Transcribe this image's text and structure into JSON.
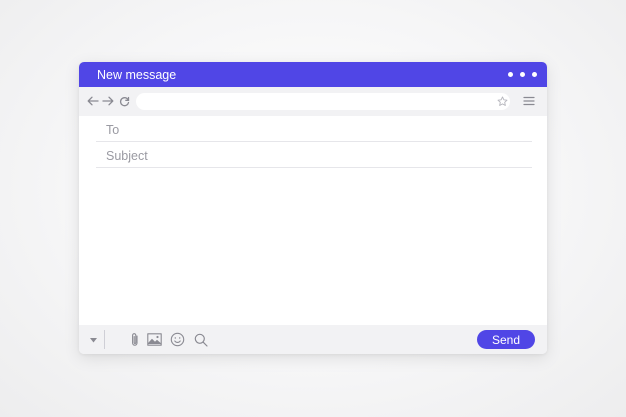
{
  "window": {
    "title": "New message",
    "accent_color": "#5046e6"
  },
  "toolbar": {
    "icons": [
      "arrow-left-icon",
      "arrow-right-icon",
      "refresh-icon",
      "star-icon",
      "hamburger-menu-icon"
    ],
    "url_value": ""
  },
  "compose": {
    "to_placeholder": "To",
    "subject_placeholder": "Subject",
    "body_value": ""
  },
  "bottom": {
    "icons": [
      "dropdown-caret-icon",
      "paperclip-icon",
      "image-icon",
      "emoji-icon",
      "search-icon"
    ],
    "send_label": "Send"
  }
}
